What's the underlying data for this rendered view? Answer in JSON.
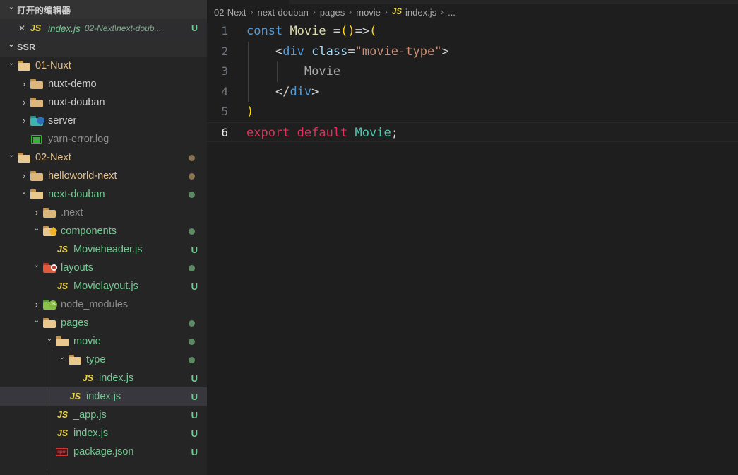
{
  "sidebar": {
    "open_editors": {
      "title": "打开的编辑器",
      "items": [
        {
          "name": "index.js",
          "path": "02-Next\\next-doub...",
          "badge": "U",
          "icon": "js-file-icon"
        }
      ]
    },
    "workspace": {
      "title": "SSR",
      "tree": [
        {
          "label": "01-Nuxt",
          "depth": 1,
          "icon": "folder-open-icon",
          "twisty": "open",
          "color": "c-orange",
          "badge": "",
          "dot": ""
        },
        {
          "label": "nuxt-demo",
          "depth": 2,
          "icon": "folder-icon",
          "twisty": "closed",
          "color": "c-white",
          "badge": "",
          "dot": ""
        },
        {
          "label": "nuxt-douban",
          "depth": 2,
          "icon": "folder-icon",
          "twisty": "closed",
          "color": "c-white",
          "badge": "",
          "dot": ""
        },
        {
          "label": "server",
          "depth": 2,
          "icon": "folder-server-icon",
          "twisty": "closed",
          "color": "c-white",
          "badge": "",
          "dot": ""
        },
        {
          "label": "yarn-error.log",
          "depth": 2,
          "icon": "log-file-icon",
          "twisty": "blank",
          "color": "c-gray",
          "badge": "",
          "dot": ""
        },
        {
          "label": "02-Next",
          "depth": 1,
          "icon": "folder-open-icon",
          "twisty": "open",
          "color": "c-orange",
          "badge": "",
          "dot": "d-orange"
        },
        {
          "label": "helloworld-next",
          "depth": 2,
          "icon": "folder-icon",
          "twisty": "closed",
          "color": "c-orange",
          "badge": "",
          "dot": "d-orange"
        },
        {
          "label": "next-douban",
          "depth": 2,
          "icon": "folder-open-icon",
          "twisty": "open",
          "color": "c-green",
          "badge": "",
          "dot": "d-green"
        },
        {
          "label": ".next",
          "depth": 3,
          "icon": "folder-icon",
          "twisty": "closed",
          "color": "c-gray",
          "badge": "",
          "dot": ""
        },
        {
          "label": "components",
          "depth": 3,
          "icon": "folder-components-icon",
          "twisty": "open",
          "color": "c-green",
          "badge": "",
          "dot": "d-green"
        },
        {
          "label": "Movieheader.js",
          "depth": 4,
          "icon": "js-file-icon",
          "twisty": "blank",
          "color": "c-green",
          "badge": "U",
          "dot": ""
        },
        {
          "label": "layouts",
          "depth": 3,
          "icon": "folder-layouts-icon",
          "twisty": "open",
          "color": "c-green",
          "badge": "",
          "dot": "d-green"
        },
        {
          "label": "Movielayout.js",
          "depth": 4,
          "icon": "js-file-icon",
          "twisty": "blank",
          "color": "c-green",
          "badge": "U",
          "dot": ""
        },
        {
          "label": "node_modules",
          "depth": 3,
          "icon": "folder-node-icon",
          "twisty": "closed",
          "color": "c-gray",
          "badge": "",
          "dot": ""
        },
        {
          "label": "pages",
          "depth": 3,
          "icon": "folder-open-icon",
          "twisty": "open",
          "color": "c-green",
          "badge": "",
          "dot": "d-green"
        },
        {
          "label": "movie",
          "depth": 4,
          "icon": "folder-open-icon",
          "twisty": "open",
          "color": "c-green",
          "badge": "",
          "dot": "d-green"
        },
        {
          "label": "type",
          "depth": 5,
          "icon": "folder-open-icon",
          "twisty": "open",
          "color": "c-green",
          "badge": "",
          "dot": "d-green"
        },
        {
          "label": "index.js",
          "depth": 6,
          "icon": "js-file-icon",
          "twisty": "blank",
          "color": "c-green",
          "badge": "U",
          "dot": ""
        },
        {
          "label": "index.js",
          "depth": 5,
          "icon": "js-file-icon",
          "twisty": "blank",
          "color": "c-green",
          "badge": "U",
          "dot": "",
          "selected": true
        },
        {
          "label": "_app.js",
          "depth": 4,
          "icon": "js-file-icon",
          "twisty": "blank",
          "color": "c-green",
          "badge": "U",
          "dot": ""
        },
        {
          "label": "index.js",
          "depth": 4,
          "icon": "js-file-icon",
          "twisty": "blank",
          "color": "c-green",
          "badge": "U",
          "dot": ""
        },
        {
          "label": "package.json",
          "depth": 4,
          "icon": "npm-file-icon",
          "twisty": "blank",
          "color": "c-green",
          "badge": "U",
          "dot": ""
        }
      ]
    }
  },
  "editor": {
    "breadcrumb": [
      "02-Next",
      "next-douban",
      "pages",
      "movie",
      "index.js",
      "..."
    ],
    "breadcrumb_file_icon": "js-file-icon",
    "breadcrumb_separator": "›",
    "code": {
      "lines": [
        {
          "num": "1",
          "tokens": [
            {
              "t": "const",
              "c": "k-blue"
            },
            {
              "t": " ",
              "c": "k-plain"
            },
            {
              "t": "Movie",
              "c": "k-yellow"
            },
            {
              "t": " =",
              "c": "k-plain"
            },
            {
              "t": "()",
              "c": "k-gold"
            },
            {
              "t": "=>",
              "c": "k-plain"
            },
            {
              "t": "(",
              "c": "k-gold"
            }
          ]
        },
        {
          "num": "2",
          "indent_guides": [
            1
          ],
          "tokens": [
            {
              "t": "    ",
              "c": "k-plain"
            },
            {
              "t": "<",
              "c": "k-plain"
            },
            {
              "t": "div",
              "c": "k-blue"
            },
            {
              "t": " ",
              "c": "k-plain"
            },
            {
              "t": "class",
              "c": "k-lblue"
            },
            {
              "t": "=",
              "c": "k-plain"
            },
            {
              "t": "\"movie-type\"",
              "c": "k-orange"
            },
            {
              "t": ">",
              "c": "k-plain"
            }
          ]
        },
        {
          "num": "3",
          "indent_guides": [
            1,
            2
          ],
          "tokens": [
            {
              "t": "        ",
              "c": "k-plain"
            },
            {
              "t": "Movie",
              "c": "k-text"
            }
          ]
        },
        {
          "num": "4",
          "indent_guides": [
            1
          ],
          "tokens": [
            {
              "t": "    ",
              "c": "k-plain"
            },
            {
              "t": "</",
              "c": "k-plain"
            },
            {
              "t": "div",
              "c": "k-blue"
            },
            {
              "t": ">",
              "c": "k-plain"
            }
          ]
        },
        {
          "num": "5",
          "tokens": [
            {
              "t": ")",
              "c": "k-gold"
            }
          ]
        },
        {
          "num": "6",
          "current": true,
          "tokens": [
            {
              "t": "export default ",
              "c": "k-crim"
            },
            {
              "t": "Movie",
              "c": "k-cyan"
            },
            {
              "t": ";",
              "c": "k-plain"
            }
          ]
        }
      ]
    }
  },
  "colors": {
    "sidebar_bg": "#252526",
    "editor_bg": "#1e1e1e",
    "selection_bg": "#37373d",
    "untracked_green": "#73c991",
    "modified_orange": "#e2c08d"
  }
}
